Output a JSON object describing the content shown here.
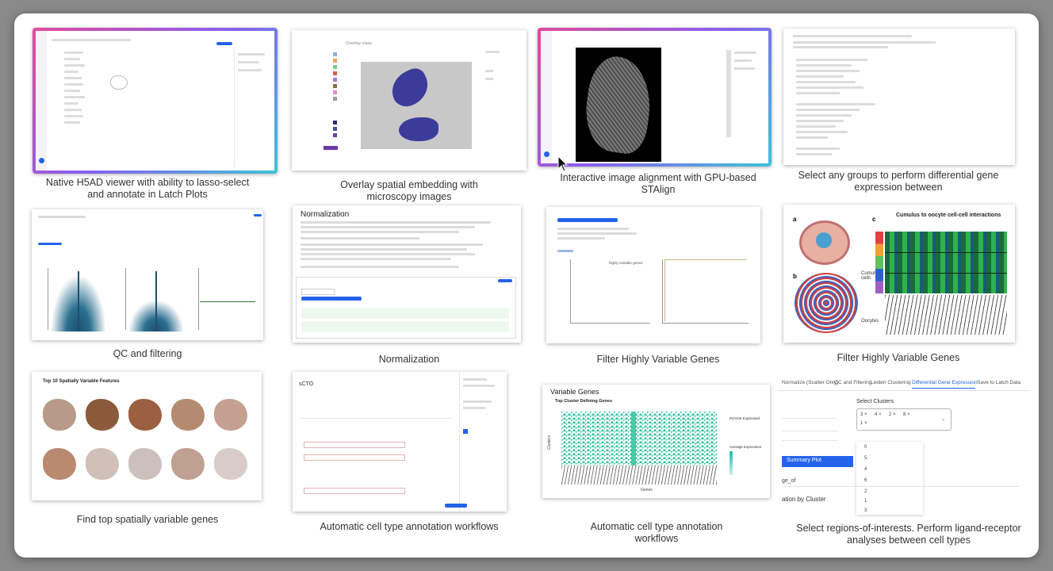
{
  "captions": [
    "Native H5AD viewer with ability to lasso-select and annotate in Latch Plots",
    "Overlay spatial embedding with microscopy images",
    "Interactive image alignment with GPU-based STAlign",
    "Select any groups to perform differential gene expression between",
    "QC and filtering",
    "Normalization",
    "Filter Highly Variable Genes",
    "Filter Highly Variable Genes",
    "Find top spatially variable genes",
    "Automatic cell type annotation workflows",
    "Automatic cell type annotation workflows",
    "Select regions-of-interests. Perform ligand-receptor analyses between cell types"
  ],
  "thumbs": {
    "overlay_title": "Overlay class",
    "norm_title": "Normalization",
    "cumulus_title": "Cumulus to oocyte cell-cell interactions",
    "cumulus_labels": [
      "a",
      "b",
      "c",
      "Cumulus cells",
      "Oocytes"
    ],
    "spatial_title": "Top 10 Spatially Variable Features",
    "varg_title": "Variable Genes",
    "varg_sub": "Top Cluster Defining Genes",
    "varg_xlabel": "Genes",
    "varg_ylabel": "Clusters",
    "varg_legend_1": "Percent Expressed",
    "varg_legend_2": "Average Expression",
    "hvg_note": "highly variable genes",
    "tabs": [
      "Normalize (Scatter Only)",
      "QC and Filtering",
      "Leiden Clustering",
      "Differential Gene Expression",
      "Save to Latch Data"
    ],
    "select_clusters": "Select Clusters",
    "summary_plot": "Summary Plot",
    "by_cluster": "ation by Cluster",
    "genes_of": "ge_of",
    "cluster_options": [
      "0",
      "5",
      "4",
      "6",
      "2",
      "1",
      "3"
    ],
    "selected_chips": [
      "3 ×",
      "4 ×",
      "2 ×",
      "8 ×",
      "1 ×"
    ]
  },
  "colors": {
    "accent": "#2463eb",
    "glow_start": "#e14c9b",
    "glow_end": "#3fc3d7",
    "heat_green": "#2db34a"
  }
}
